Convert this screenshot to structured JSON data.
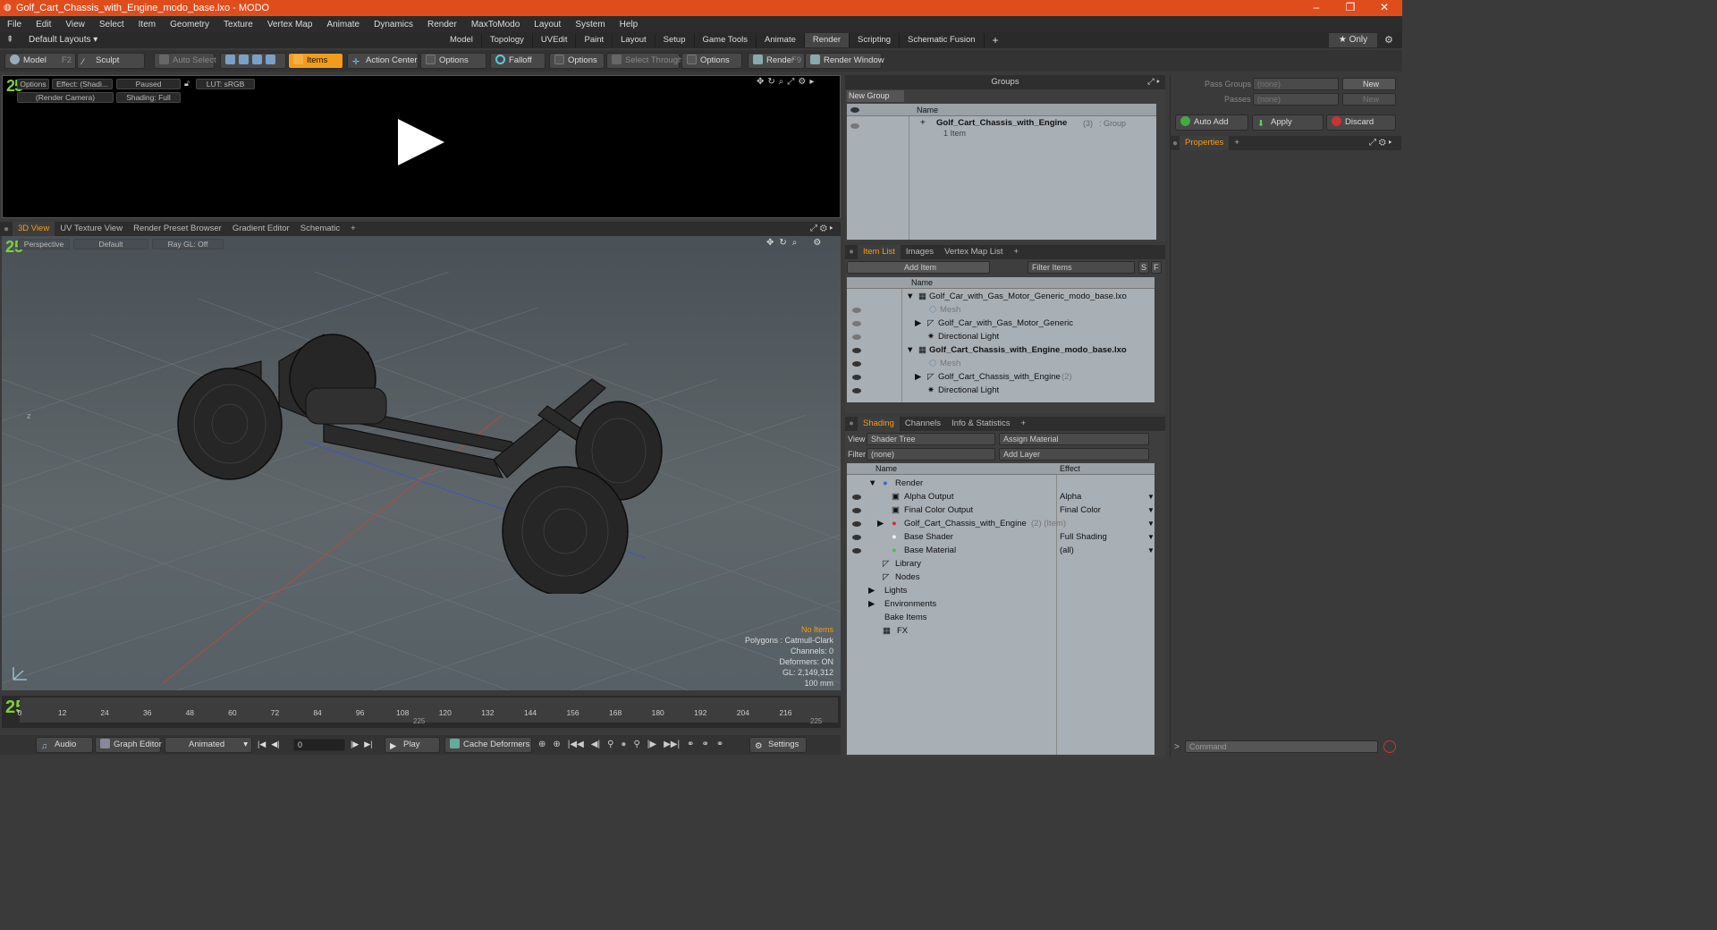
{
  "window": {
    "title": "Golf_Cart_Chassis_with_Engine_modo_base.lxo - MODO",
    "minimize": "–",
    "maximize": "❐",
    "close": "✕"
  },
  "menu": [
    "File",
    "Edit",
    "View",
    "Select",
    "Item",
    "Geometry",
    "Texture",
    "Vertex Map",
    "Animate",
    "Dynamics",
    "Render",
    "MaxToModo",
    "Layout",
    "System",
    "Help"
  ],
  "layoutbar": {
    "layouts": "Default Layouts ▾",
    "tabs": [
      "Model",
      "Topology",
      "UVEdit",
      "Paint",
      "Layout",
      "Setup",
      "Game Tools",
      "Animate",
      "Render",
      "Scripting",
      "Schematic Fusion"
    ],
    "active_tab": "Render",
    "add": "+",
    "only": "★ Only"
  },
  "toolbar": {
    "model": "Model",
    "model_key": "F2",
    "sculpt": "Sculpt",
    "auto_select": "Auto Select",
    "items": "Items",
    "action_center": "Action Center",
    "options1": "Options",
    "falloff": "Falloff",
    "options2": "Options",
    "select_through": "Select Through",
    "options3": "Options",
    "render": "Render",
    "render_key": "F9",
    "render_window": "Render Window"
  },
  "render_view": {
    "options": "Options",
    "effect": "Effect: (Shadi...",
    "paused": "Paused",
    "lut": "LUT: sRGB",
    "camera": "(Render Camera)",
    "shading": "Shading: Full",
    "logo": "25"
  },
  "view_tabs": {
    "tabs": [
      "3D View",
      "UV Texture View",
      "Render Preset Browser",
      "Gradient Editor",
      "Schematic"
    ],
    "active": "3D View",
    "add": "+"
  },
  "viewport": {
    "perspective": "Perspective",
    "default": "Default",
    "raygl": "Ray GL: Off",
    "logo": "25",
    "axis_z": "z",
    "hud": {
      "no_items": "No Items",
      "polygons": "Polygons : Catmull-Clark",
      "channels": "Channels: 0",
      "deformers": "Deformers: ON",
      "gl": "GL: 2,149,312",
      "scale": "100 mm"
    }
  },
  "timeline": {
    "ticks": [
      "0",
      "12",
      "24",
      "36",
      "48",
      "60",
      "72",
      "84",
      "96",
      "108",
      "120",
      "132",
      "144",
      "156",
      "168",
      "180",
      "192",
      "204",
      "216"
    ],
    "sub_mid": "225",
    "sub_end": "225"
  },
  "bottom": {
    "audio": "Audio",
    "graph_editor": "Graph Editor",
    "animated": "Animated",
    "frame": "0",
    "play": "Play",
    "cache": "Cache Deformers",
    "settings": "Settings"
  },
  "groups": {
    "title": "Groups",
    "new_group": "New Group",
    "col_name": "Name",
    "row_name": "Golf_Cart_Chassis_with_Engine",
    "row_count": "(3)",
    "row_type": ": Group",
    "row_sub": "1 Item"
  },
  "item_list": {
    "tabs": [
      "Item List",
      "Images",
      "Vertex Map List"
    ],
    "add_item": "Add Item",
    "filter": "Filter Items",
    "s": "S",
    "f": "F",
    "col_name": "Name",
    "rows": [
      {
        "label": "Golf_Car_with_Gas_Motor_Generic_modo_base.lxo",
        "bold": false
      },
      {
        "label": "Mesh",
        "dim": true
      },
      {
        "label": "Golf_Car_with_Gas_Motor_Generic"
      },
      {
        "label": "Directional Light"
      },
      {
        "label": "Golf_Cart_Chassis_with_Engine_modo_base.lxo",
        "bold": true
      },
      {
        "label": "Mesh",
        "dim": true
      },
      {
        "label": "Golf_Cart_Chassis_with_Engine",
        "suffix": "(2)"
      },
      {
        "label": "Directional Light"
      }
    ]
  },
  "shading": {
    "tabs": [
      "Shading",
      "Channels",
      "Info & Statistics"
    ],
    "view_label": "View",
    "view_value": "Shader Tree",
    "assign": "Assign Material",
    "filter_label": "Filter",
    "filter_value": "(none)",
    "add_layer": "Add Layer",
    "col_name": "Name",
    "col_effect": "Effect",
    "rows": [
      {
        "label": "Render",
        "effect": ""
      },
      {
        "label": "Alpha Output",
        "effect": "Alpha"
      },
      {
        "label": "Final Color Output",
        "effect": "Final Color"
      },
      {
        "label": "Golf_Cart_Chassis_with_Engine",
        "suffix": "(2) (Item)",
        "effect": ""
      },
      {
        "label": "Base Shader",
        "effect": "Full Shading"
      },
      {
        "label": "Base Material",
        "effect": "(all)"
      },
      {
        "label": "Library",
        "effect": ""
      },
      {
        "label": "Nodes",
        "effect": ""
      },
      {
        "label": "Lights",
        "effect": ""
      },
      {
        "label": "Environments",
        "effect": ""
      },
      {
        "label": "Bake Items",
        "effect": ""
      },
      {
        "label": "FX",
        "effect": ""
      }
    ]
  },
  "properties": {
    "pass_groups": "Pass Groups",
    "passes": "Passes",
    "none": "(none)",
    "new": "New",
    "auto_add": "Auto Add",
    "apply": "Apply",
    "discard": "Discard",
    "tab": "Properties",
    "command": "Command"
  }
}
